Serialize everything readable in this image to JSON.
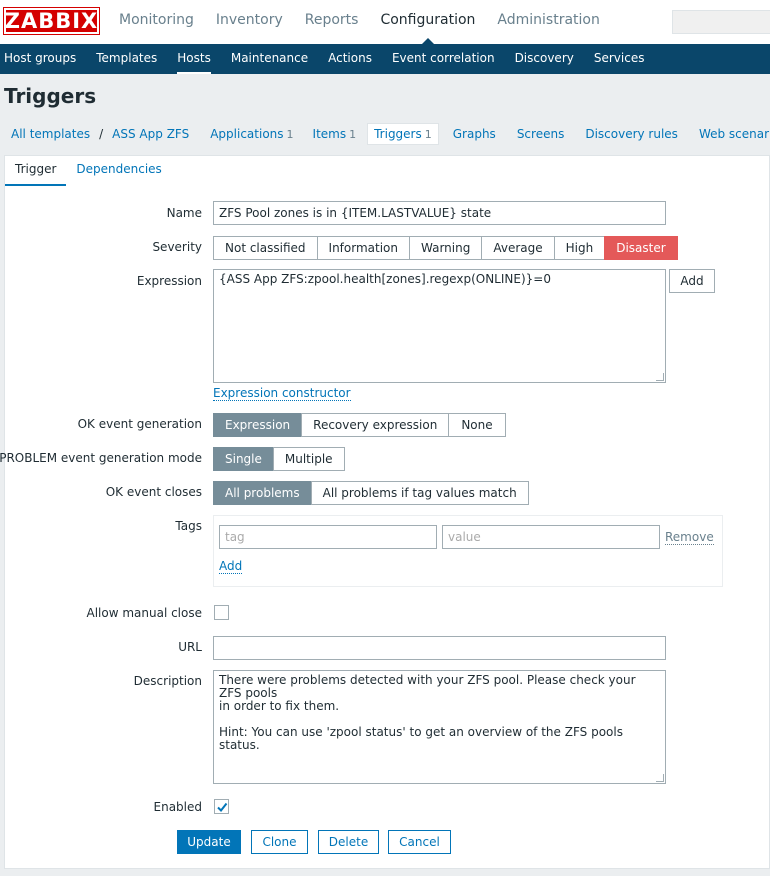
{
  "brand": {
    "logo": "ZABBIX"
  },
  "topnav": [
    "Monitoring",
    "Inventory",
    "Reports",
    "Configuration",
    "Administration"
  ],
  "topnav_active": "Configuration",
  "subnav": [
    "Host groups",
    "Templates",
    "Hosts",
    "Maintenance",
    "Actions",
    "Event correlation",
    "Discovery",
    "Services"
  ],
  "subnav_active": "Hosts",
  "page_title": "Triggers",
  "objnav": {
    "all_templates": "All templates",
    "separator": "/",
    "template": "ASS App ZFS",
    "applications": "Applications",
    "applications_count": "1",
    "items": "Items",
    "items_count": "1",
    "triggers": "Triggers",
    "triggers_count": "1",
    "graphs": "Graphs",
    "screens": "Screens",
    "discovery_rules": "Discovery rules",
    "web_scenarios": "Web scenarios"
  },
  "form_tabs": [
    "Trigger",
    "Dependencies"
  ],
  "form": {
    "name_label": "Name",
    "name_value": "ZFS Pool zones is in {ITEM.LASTVALUE} state",
    "severity_label": "Severity",
    "severity_options": [
      "Not classified",
      "Information",
      "Warning",
      "Average",
      "High",
      "Disaster"
    ],
    "severity_selected": "Disaster",
    "expression_label": "Expression",
    "expression_value": "{ASS App ZFS:zpool.health[zones].regexp(ONLINE)}=0",
    "expression_add": "Add",
    "expression_constructor": "Expression constructor",
    "ok_event_generation_label": "OK event generation",
    "ok_event_generation_options": [
      "Expression",
      "Recovery expression",
      "None"
    ],
    "problem_mode_label": "PROBLEM event generation mode",
    "problem_mode_options": [
      "Single",
      "Multiple"
    ],
    "ok_event_closes_label": "OK event closes",
    "ok_event_closes_options": [
      "All problems",
      "All problems if tag values match"
    ],
    "tags_label": "Tags",
    "tag_placeholder": "tag",
    "value_placeholder": "value",
    "tag_remove": "Remove",
    "tag_add": "Add",
    "allow_manual_close_label": "Allow manual close",
    "allow_manual_close_checked": false,
    "url_label": "URL",
    "url_value": "",
    "description_label": "Description",
    "description_line1": "There were problems detected with your ZFS pool. Please check your ZFS pools",
    "description_line2": "in order to fix them.",
    "description_line3": "Hint: You can use 'zpool status' to get an overview of the ZFS pools status.",
    "enabled_label": "Enabled",
    "enabled_checked": true
  },
  "buttons": {
    "update": "Update",
    "clone": "Clone",
    "delete": "Delete",
    "cancel": "Cancel"
  },
  "colors": {
    "brand_red": "#d40000",
    "nav_blue": "#0a466a",
    "link_blue": "#0275b8",
    "disaster": "#e45959",
    "selected_gray": "#768d99"
  }
}
